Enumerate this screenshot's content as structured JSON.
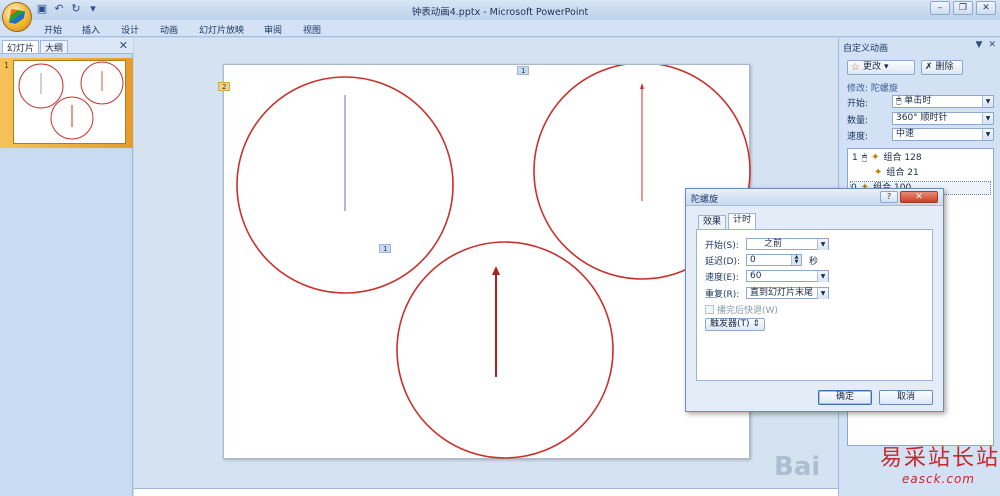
{
  "app": {
    "window_title": "钟表动画4.pptx - Microsoft PowerPoint",
    "ribbon_tabs": [
      "开始",
      "插入",
      "设计",
      "动画",
      "幻灯片放映",
      "审阅",
      "视图"
    ]
  },
  "left_pane": {
    "tabs": [
      "幻灯片",
      "大纲"
    ],
    "slide_number": "1"
  },
  "slide": {
    "anim_tags": {
      "top": "1",
      "left": "2",
      "mid": "1"
    }
  },
  "custom_animation": {
    "title": "自定义动画",
    "change_button": "更改",
    "delete_button": "删除",
    "modify_label": "修改: 陀螺旋",
    "start_label": "开始:",
    "start_value": "单击时",
    "amount_label": "数量:",
    "amount_value": "360° 顺时针",
    "speed_label": "速度:",
    "speed_value": "中速",
    "list": [
      {
        "num": "1",
        "name": "组合 128"
      },
      {
        "num": "",
        "name": "组合 21"
      },
      {
        "num": "0",
        "name": "组合 100"
      }
    ]
  },
  "dialog": {
    "title": "陀螺旋",
    "help": "?",
    "tabs": [
      "效果",
      "计时"
    ],
    "start_label": "开始(S):",
    "start_value": "之前",
    "delay_label": "延迟(D):",
    "delay_value": "0",
    "delay_unit": "秒",
    "speed_label": "速度(E):",
    "speed_value": "60",
    "repeat_label": "重复(R):",
    "repeat_value": "直到幻灯片末尾",
    "rewind_label": "播完后快退(W)",
    "trigger_label": "触发器(T)",
    "ok": "确定",
    "cancel": "取消"
  },
  "watermark": {
    "text": "易采站长站",
    "url": "easck.com",
    "baidu": "Bai"
  },
  "colors": {
    "clock_red": "#c9302c",
    "hand_blue": "#7788cc"
  }
}
